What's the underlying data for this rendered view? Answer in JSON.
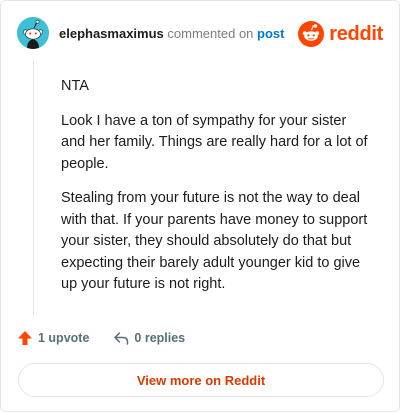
{
  "header": {
    "username": "elephasmaximus",
    "action_text": "commented on",
    "post_link": "post",
    "brand": "reddit"
  },
  "comment": {
    "paragraphs": [
      "NTA",
      "Look I have a ton of sympathy for your sister and her family. Things are really hard for a lot of people.",
      "Stealing from your future is not the way to deal with that. If your parents have money to support your sister, they should absolutely do that but expecting their barely adult younger kid to give up your future is not right."
    ]
  },
  "actions": {
    "upvote_label": "1 upvote",
    "replies_label": "0 replies"
  },
  "footer": {
    "view_more_label": "View more on Reddit"
  },
  "colors": {
    "brand": "#ff4500",
    "link": "#0079d3",
    "upvote": "#ff4500",
    "view_more_text": "#d93a00",
    "avatar": "#3dbfd6"
  },
  "icons": {
    "avatar": "snoo-avatar-icon",
    "brand": "reddit-logo-icon",
    "upvote": "upvote-arrow-icon",
    "replies": "reply-arrow-icon"
  }
}
